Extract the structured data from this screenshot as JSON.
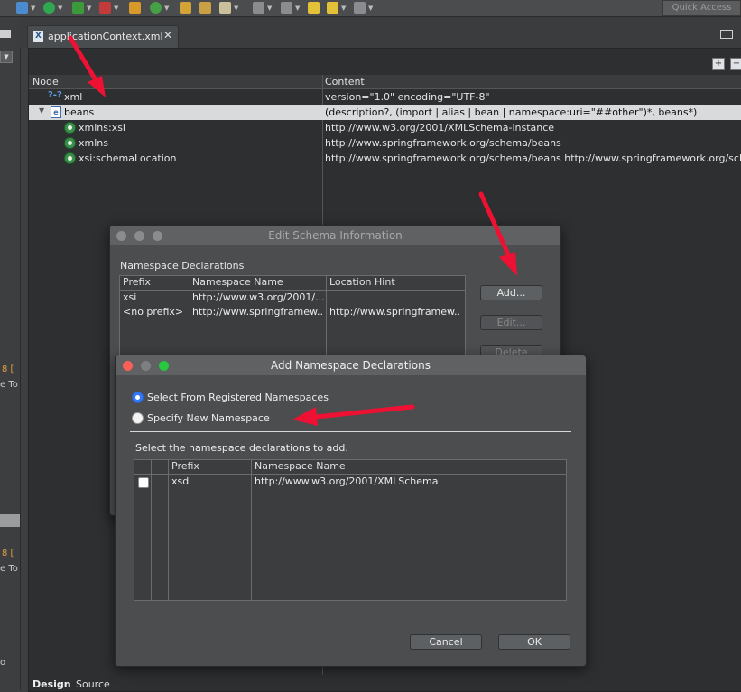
{
  "toolbar": {
    "quick_access": "Quick Access"
  },
  "left_strip": {
    "items": [
      "8 [",
      "e To",
      "8 [",
      "e To",
      "o"
    ]
  },
  "editor": {
    "tab_title": "applicationContext.xml",
    "tab_icon_letter": "X",
    "tab_close": "✕",
    "columns": {
      "node": "Node",
      "content": "Content"
    },
    "rows": [
      {
        "node": "xml",
        "content": "version=\"1.0\" encoding=\"UTF-8\""
      },
      {
        "node": "beans",
        "content": "(description?, (import | alias | bean | namespace:uri=\"##other\")*, beans*)"
      },
      {
        "node": "xmlns:xsi",
        "content": "http://www.w3.org/2001/XMLSchema-instance"
      },
      {
        "node": "xmlns",
        "content": "http://www.springframework.org/schema/beans"
      },
      {
        "node": "xsi:schemaLocation",
        "content": "http://www.springframework.org/schema/beans http://www.springframework.org/schema"
      }
    ],
    "row_icons": {
      "xml": "?-?",
      "beans": "e"
    },
    "bottom_tabs": [
      "Design",
      "Source"
    ]
  },
  "schema_dialog": {
    "title": "Edit Schema Information",
    "section": "Namespace Declarations",
    "columns": {
      "prefix": "Prefix",
      "namespace": "Namespace Name",
      "location": "Location Hint"
    },
    "rows": [
      {
        "prefix": "xsi",
        "namespace": "http://www.w3.org/2001/...",
        "location": ""
      },
      {
        "prefix": "<no prefix>",
        "namespace": "http://www.springframew...",
        "location": "http://www.springframew..."
      }
    ],
    "buttons": {
      "add": "Add...",
      "edit": "Edit...",
      "delete": "Delete"
    }
  },
  "add_dialog": {
    "title": "Add Namespace Declarations",
    "radio_registered": "Select From Registered Namespaces",
    "radio_new": "Specify New Namespace",
    "instruction": "Select the namespace declarations to add.",
    "columns": {
      "prefix": "Prefix",
      "namespace": "Namespace Name"
    },
    "rows": [
      {
        "checked": false,
        "prefix": "xsd",
        "namespace": "http://www.w3.org/2001/XMLSchema"
      }
    ],
    "buttons": {
      "cancel": "Cancel",
      "ok": "OK"
    }
  },
  "colors": {
    "accent": "#3478f6",
    "annotation": "#ee1133",
    "close": "#fc5f57",
    "minimize": "#fdbc2e",
    "maximize": "#28c840"
  }
}
